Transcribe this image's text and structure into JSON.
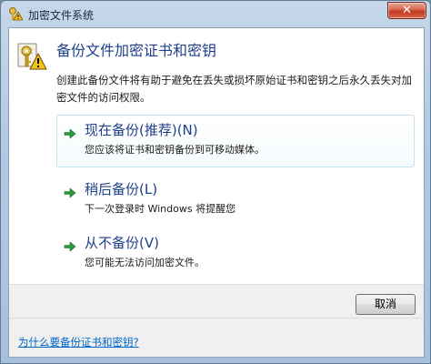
{
  "window": {
    "title": "加密文件系统",
    "close_label": "✕"
  },
  "header": {
    "title": "备份文件加密证书和密钥",
    "description": "创建此备份文件将有助于避免在丢失或损坏原始证书和密钥之后永久丢失对加密文件的访问权限。"
  },
  "options": [
    {
      "title": "现在备份(推荐)(N)",
      "subtitle": "您应该将证书和密钥备份到可移动媒体。"
    },
    {
      "title": "稍后备份(L)",
      "subtitle": "下一次登录时 Windows 将提醒您"
    },
    {
      "title": "从不备份(V)",
      "subtitle": "您可能无法访问加密文件。"
    }
  ],
  "buttons": {
    "cancel": "取消"
  },
  "footer": {
    "help_link": "为什么要备份证书和密钥?"
  },
  "colors": {
    "accent_text": "#1e3f8a",
    "arrow_green": "#2a9a3a",
    "link": "#0066cc"
  },
  "icons": {
    "title": "key-warning-icon",
    "header": "certificate-key-icon",
    "option_arrow": "green-arrow-icon"
  }
}
